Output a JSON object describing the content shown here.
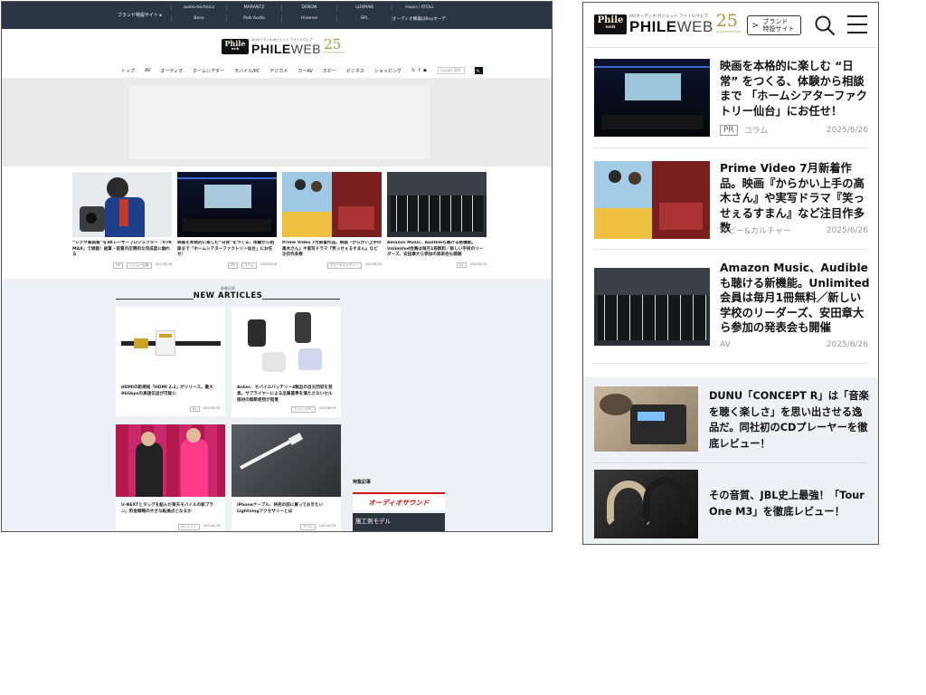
{
  "desktop": {
    "topbar": {
      "brand_sites_label": "ブランド特設サイト ▸",
      "brands": [
        "audio-technica",
        "MARANTZ",
        "DENON",
        "LUXMAN",
        "moon / ATOLL",
        "Bose",
        "Polk Audio",
        "Hisense",
        "SPL",
        "オーディオ機器はBuyオーディオベスト"
      ]
    },
    "logo": {
      "box": "Phile",
      "box_sub": "web",
      "word_bold": "PHILE",
      "word_light": "WEB",
      "anniv": "25",
      "anniv_sub": "th ANNIVERSARY",
      "subcopy": "AV/オーディオ/ガジェット ファイルウェブ"
    },
    "nav": {
      "items": [
        "トップ",
        "AV",
        "オーディオ",
        "ホームシアター",
        "モバイル/PC",
        "デジカメ",
        "カーAV",
        "ホビー",
        "ビジネス",
        "ショッピング"
      ],
      "sns": [
        "𝕏",
        "f",
        "▶"
      ],
      "search_placeholder": "Google 提供",
      "search_button": "🔍"
    },
    "features": [
      {
        "title": "“レグザ高画質”を4Kレーザープロジェクター「V7R MAX」で堪能！画質・音質の圧倒的な完成度に触れる",
        "tags": [
          "PR",
          "レビュー記事"
        ],
        "date": "2025/6/26"
      },
      {
        "title": "映画を本格的に楽しむ“日常”をつくる、体験から相談まで「ホームシアターファクトリー仙台」にお任せ！",
        "tags": [
          "PR",
          "コラム"
        ],
        "date": "2025/6/26"
      },
      {
        "title": "Prime Video 7月新着作品。映画『からかい上手の高木さん』や実写ドラマ『笑っせぇるすまん』など注目作多数",
        "tags": [
          "ホビー&カルチャー"
        ],
        "date": "2025/6/26"
      },
      {
        "title": "Amazon Music、Audibleも聴ける新機能。Unlimited会員は毎月1冊無料／新しい学校のリーダーズ、安田章大ら参加の発表会も開催",
        "tags": [
          "AV"
        ],
        "date": "2025/6/26"
      }
    ],
    "new_articles": {
      "kicker": "新着記事",
      "heading": "NEW ARTICLES",
      "cards": [
        {
          "title": "HDMIの新規格「HDMI 2.2」がリリース。最大96Gbpsの高速伝送が可能に",
          "tags": [
            "AV"
          ],
          "date": "2025/6/26"
        },
        {
          "title": "Anker、モバイルバッテリー4製品の自主回収を発表。サプライヤーによる品質基準を満たさないセル部材の無断使用が発覚",
          "tags": [
            "モバイル/PC"
          ],
          "date": "2025/6/26"
        },
        {
          "title": "U-NEXTとタッグを組んだ楽天モバイルの新プラン。料金戦略の大きな転換点となるか",
          "tags": [
            "ガジェット"
          ],
          "date": "2025/6/26"
        },
        {
          "title": "iPhoneケーブル、将売の前に買っておきたいLightningアクセサリーとは",
          "tags": [
            "コラム"
          ],
          "date": "2025/6/26"
        }
      ]
    },
    "special": {
      "label": "特集記事",
      "banner1": "オーディオサウンド",
      "banner2": "施工例モデル"
    }
  },
  "mobile": {
    "header": {
      "brand_chevron": ">",
      "brand_line1": "ブランド",
      "brand_line2": "特設サイト"
    },
    "items": [
      {
        "title": "映画を本格的に楽しむ “日常” をつくる、体験から相談まで 「ホームシアターファクトリー仙台」にお任せ！",
        "tag": "PR",
        "category": "コラム",
        "date": "2025/6/26"
      },
      {
        "title": "Prime Video 7月新着作品。映画『からかい上手の高木さん』や実写ドラマ『笑っせぇるすまん』など注目作多数",
        "tag": "",
        "category": "ホビー&カルチャー",
        "date": "2025/6/26"
      },
      {
        "title": "Amazon Music、Audibleも聴ける新機能。Unlimited会員は毎月1冊無料／新しい学校のリーダーズ、安田章大ら参加の発表会も開催",
        "tag": "",
        "category": "AV",
        "date": "2025/6/26"
      }
    ],
    "gray_items": [
      {
        "title": "DUNU「CONCEPT R」は「音楽を聴く楽しさ」を思い出させる逸品だ。同社初のCDプレーヤーを徹底レビュー！"
      },
      {
        "title": "その音質、JBL史上最強！「Tour One M3」を徹底レビュー！"
      }
    ]
  }
}
